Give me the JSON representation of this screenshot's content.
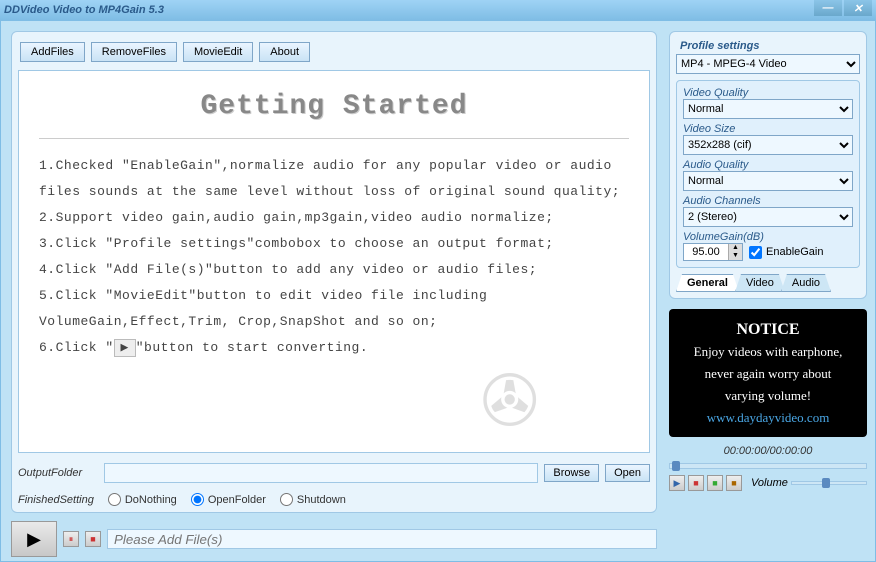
{
  "window": {
    "title": "DDVideo Video to MP4Gain 5.3"
  },
  "toolbar": {
    "addfiles": "AddFiles",
    "removefiles": "RemoveFiles",
    "movieedit": "MovieEdit",
    "about": "About"
  },
  "gettingStarted": {
    "title": "Getting Started",
    "items": [
      "1.Checked \"EnableGain\",normalize audio for any popular video or audio files sounds at the same level without loss of original sound quality;",
      "2.Support video gain,audio gain,mp3gain,video audio normalize;",
      "3.Click \"Profile settings\"combobox to choose an output format;",
      "4.Click \"Add File(s)\"button to add any video or audio files;",
      "5.Click \"MovieEdit\"button to edit video file including VolumeGain,Effect,Trim, Crop,SnapShot and so on;",
      "6.Click \"     \"button to start converting."
    ]
  },
  "output": {
    "label": "OutputFolder",
    "value": "",
    "browse": "Browse",
    "open": "Open"
  },
  "finished": {
    "label": "FinishedSetting",
    "opt1": "DoNothing",
    "opt2": "OpenFolder",
    "opt3": "Shutdown",
    "selected": "OpenFolder"
  },
  "status": {
    "placeholder": "Please Add File(s)"
  },
  "profile": {
    "label": "Profile settings",
    "value": "MP4 - MPEG-4 Video",
    "videoQuality": {
      "label": "Video Quality",
      "value": "Normal"
    },
    "videoSize": {
      "label": "Video Size",
      "value": "352x288 (cif)"
    },
    "audioQuality": {
      "label": "Audio Quality",
      "value": "Normal"
    },
    "audioChannels": {
      "label": "Audio Channels",
      "value": "2 (Stereo)"
    },
    "volumeGain": {
      "label": "VolumeGain(dB)",
      "value": "95.00",
      "enableLabel": "EnableGain"
    },
    "tabs": {
      "general": "General",
      "video": "Video",
      "audio": "Audio"
    }
  },
  "notice": {
    "title": "NOTICE",
    "line1": "Enjoy videos with earphone,",
    "line2": "never again worry about",
    "line3": "varying volume!",
    "url": "www.daydayvideo.com"
  },
  "player": {
    "timecode": "00:00:00/00:00:00",
    "volumeLabel": "Volume"
  }
}
